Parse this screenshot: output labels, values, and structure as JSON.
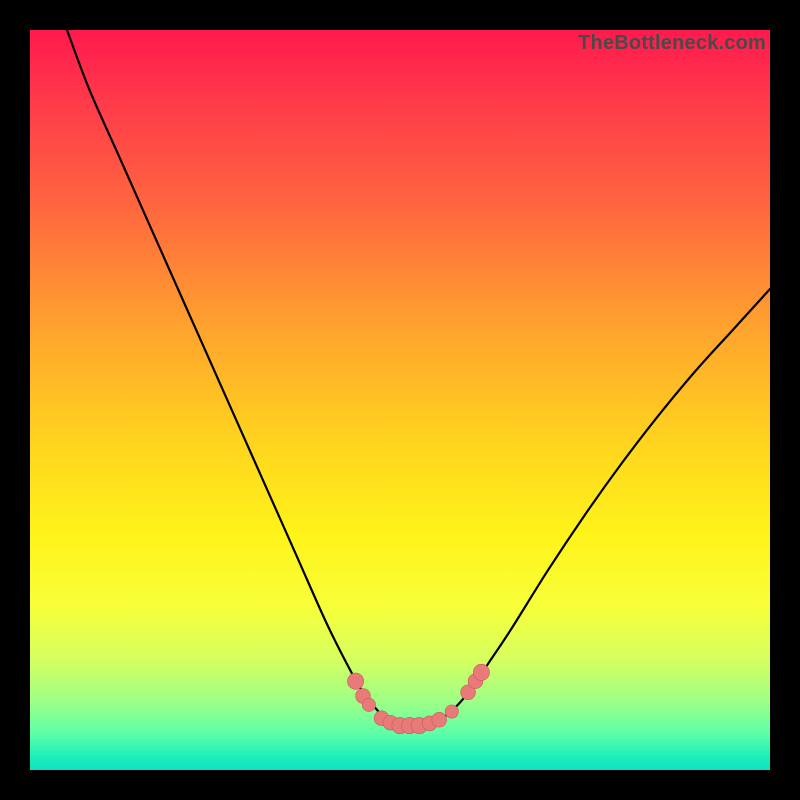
{
  "watermark": "TheBottleneck.com",
  "colors": {
    "frame": "#000000",
    "gradient_top": "#ff1a4d",
    "gradient_bottom": "#10e0c0",
    "curve_stroke": "#000000",
    "marker_fill": "#e97a7a",
    "marker_stroke": "#c95a5a"
  },
  "chart_data": {
    "type": "line",
    "title": "",
    "xlabel": "",
    "ylabel": "",
    "xlim": [
      0,
      100
    ],
    "ylim": [
      0,
      100
    ],
    "grid": false,
    "legend": false,
    "note": "Axes unlabeled in source image; x is horizontal position (%), y is vertical position (% from top). Values estimated from pixel positions.",
    "series": [
      {
        "name": "bottleneck-curve",
        "x": [
          5,
          8,
          12,
          16,
          20,
          24,
          28,
          32,
          36,
          40,
          43,
          45,
          47,
          48.5,
          50,
          52,
          54,
          56,
          58,
          60,
          62,
          65,
          70,
          75,
          80,
          85,
          90,
          95,
          100
        ],
        "y": [
          0,
          8,
          17,
          26,
          35,
          44,
          53,
          62,
          71,
          80,
          86,
          89.5,
          92,
          93.5,
          94,
          94,
          93.7,
          92.8,
          91,
          88.5,
          85.5,
          81,
          73,
          65.5,
          58.5,
          52,
          46,
          40.5,
          35
        ]
      }
    ],
    "markers": {
      "name": "highlight-dots",
      "note": "Pink dots near the trough of the curve.",
      "points": [
        {
          "x": 44.0,
          "y": 88.0,
          "r": 1.1
        },
        {
          "x": 45.0,
          "y": 90.0,
          "r": 1.0
        },
        {
          "x": 45.8,
          "y": 91.2,
          "r": 0.9
        },
        {
          "x": 47.5,
          "y": 93.0,
          "r": 1.0
        },
        {
          "x": 48.7,
          "y": 93.6,
          "r": 1.0
        },
        {
          "x": 50.0,
          "y": 94.0,
          "r": 1.1
        },
        {
          "x": 51.3,
          "y": 94.0,
          "r": 1.1
        },
        {
          "x": 52.6,
          "y": 94.0,
          "r": 1.1
        },
        {
          "x": 54.0,
          "y": 93.7,
          "r": 1.0
        },
        {
          "x": 55.3,
          "y": 93.2,
          "r": 1.0
        },
        {
          "x": 57.0,
          "y": 92.1,
          "r": 0.9
        },
        {
          "x": 59.2,
          "y": 89.5,
          "r": 1.0
        },
        {
          "x": 60.2,
          "y": 88.0,
          "r": 1.0
        },
        {
          "x": 61.0,
          "y": 86.8,
          "r": 1.1
        }
      ]
    }
  }
}
